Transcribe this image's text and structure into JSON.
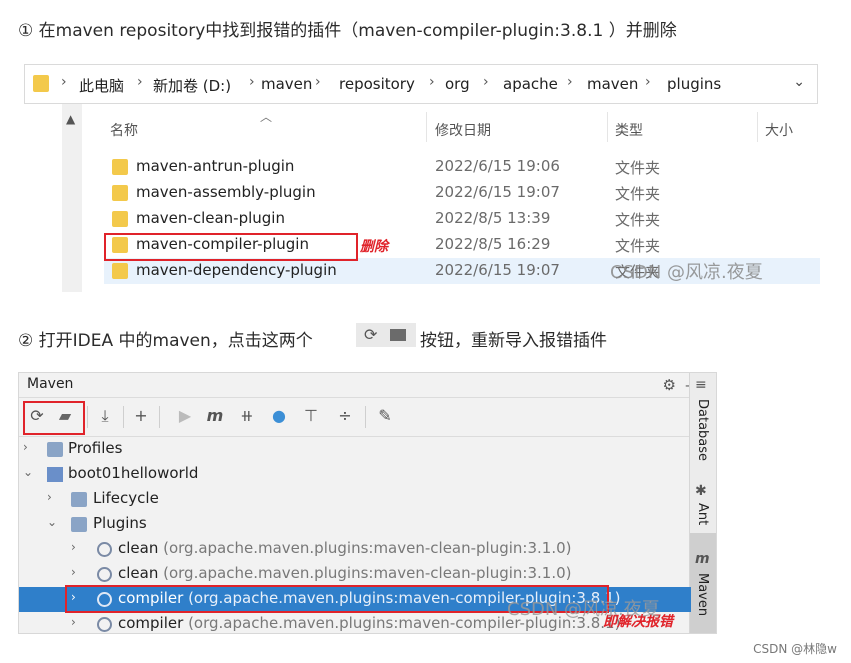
{
  "step1": "① 在maven repository中找到报错的插件（maven-compiler-plugin:3.8.1 ）并删除",
  "step2_before": "② 打开IDEA 中的maven，点击这两个",
  "step2_after": "按钮，重新导入报错插件",
  "explorer": {
    "breadcrumbs": [
      "此电脑",
      "新加卷 (D:)",
      "maven",
      "repository",
      "org",
      "apache",
      "maven",
      "plugins"
    ],
    "columns": {
      "name": "名称",
      "modified": "修改日期",
      "type": "类型",
      "size": "大小"
    },
    "rows": [
      {
        "name": "maven-antrun-plugin",
        "date": "2022/6/15 19:06",
        "type": "文件夹"
      },
      {
        "name": "maven-assembly-plugin",
        "date": "2022/6/15 19:07",
        "type": "文件夹"
      },
      {
        "name": "maven-clean-plugin",
        "date": "2022/8/5 13:39",
        "type": "文件夹"
      },
      {
        "name": "maven-compiler-plugin",
        "date": "2022/8/5 16:29",
        "type": "文件夹"
      },
      {
        "name": "maven-dependency-plugin",
        "date": "2022/6/15 19:07",
        "type": "文件夹"
      }
    ],
    "annotation": "删除",
    "watermark": "CSDN @风凉.夜夏"
  },
  "maven": {
    "title": "Maven",
    "side_tabs": [
      "Database",
      "Ant",
      "Maven"
    ],
    "tree": [
      {
        "label": "Profiles",
        "sub": ""
      },
      {
        "label": "boot01helloworld",
        "sub": ""
      },
      {
        "label": "Lifecycle",
        "sub": ""
      },
      {
        "label": "Plugins",
        "sub": ""
      },
      {
        "label": "clean",
        "sub": "(org.apache.maven.plugins:maven-clean-plugin:3.1.0)"
      },
      {
        "label": "clean",
        "sub": "(org.apache.maven.plugins:maven-clean-plugin:3.1.0)"
      },
      {
        "label": "compiler",
        "sub": "(org.apache.maven.plugins:maven-compiler-plugin:3.8.1)"
      },
      {
        "label": "compiler",
        "sub": "(org.apache.maven.plugins:maven-compiler-plugin:3.8.1)"
      }
    ],
    "annotation": "即解决报错",
    "watermark": "CSDN @风凉.夜夏"
  },
  "footer_credit": "CSDN @林隐w"
}
